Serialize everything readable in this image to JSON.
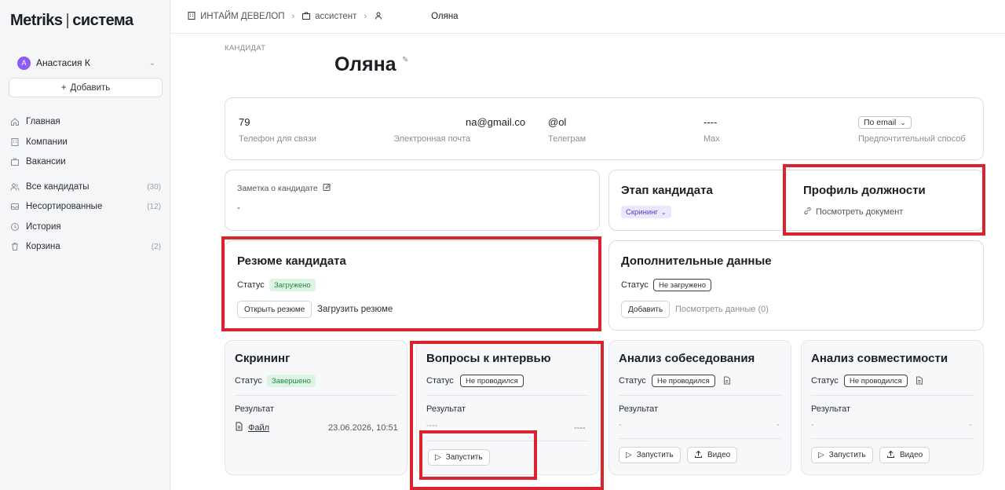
{
  "sidebar": {
    "logo_left": "Metriks",
    "logo_sep": "|",
    "logo_right": "система",
    "user": {
      "initial": "А",
      "name": "Анастасия К"
    },
    "add_label": "Добавить",
    "nav": [
      {
        "label": "Главная",
        "icon": "home-icon",
        "count": ""
      },
      {
        "label": "Компании",
        "icon": "building-icon",
        "count": ""
      },
      {
        "label": "Вакансии",
        "icon": "briefcase-icon",
        "count": ""
      },
      {
        "label": "Все кандидаты",
        "icon": "users-icon",
        "count": "(30)"
      },
      {
        "label": "Несортированные",
        "icon": "inbox-icon",
        "count": "(12)"
      },
      {
        "label": "История",
        "icon": "history-icon",
        "count": ""
      },
      {
        "label": "Корзина",
        "icon": "trash-icon",
        "count": "(2)"
      }
    ]
  },
  "breadcrumb": {
    "company": "ИНТАЙМ ДЕВЕЛОП",
    "vacancy": "ассистент",
    "candidate": "Оляна"
  },
  "candidate": {
    "label": "КАНДИДАТ",
    "name": "Оляна"
  },
  "contacts": [
    {
      "value": "79",
      "label": "Телефон для связи"
    },
    {
      "value": "na@gmail.co",
      "label": "Электронная почта"
    },
    {
      "value": "@ol",
      "label": "Телеграм"
    },
    {
      "value": "----",
      "label": "Max"
    },
    {
      "value": "По email",
      "label": "Предпочтительный способ"
    }
  ],
  "note": {
    "title": "Заметка о кандидате",
    "value": "-"
  },
  "stage": {
    "title": "Этап кандидата",
    "value": "Скрининг"
  },
  "profile": {
    "title": "Профиль должности",
    "link": "Посмотреть документ"
  },
  "resume": {
    "title": "Резюме кандидата",
    "status_label": "Статус",
    "status": "Загружено",
    "open_btn": "Открыть резюме",
    "upload_btn": "Загрузить резюме"
  },
  "extra": {
    "title": "Дополнительные данные",
    "status_label": "Статус",
    "status": "Не загружено",
    "add_btn": "Добавить",
    "view_btn": "Посмотреть данные (0)"
  },
  "screening": {
    "title": "Скрининг",
    "status_label": "Статус",
    "status": "Завершено",
    "result_label": "Результат",
    "file": "Файл",
    "date": "23.06.2026, 10:51"
  },
  "questions": {
    "title": "Вопросы к интервью",
    "status_label": "Статус",
    "status": "Не проводился",
    "result_label": "Результат",
    "result_left": "----",
    "result_right": "----",
    "run_btn": "Запустить"
  },
  "analysis": {
    "title": "Анализ собеседования",
    "status_label": "Статус",
    "status": "Не проводился",
    "result_label": "Результат",
    "result_left": "-",
    "result_right": "-",
    "run_btn": "Запустить",
    "video_btn": "Видео"
  },
  "compat": {
    "title": "Анализ совместимости",
    "status_label": "Статус",
    "status": "Не проводился",
    "result_label": "Результат",
    "result_left": "-",
    "result_right": "-",
    "run_btn": "Запустить",
    "video_btn": "Видео"
  },
  "colors": {
    "highlight": "#d9232e",
    "avatar": "#8b5cf6",
    "badge_green": "#dcf5e3",
    "badge_purple": "#ece6ff"
  }
}
